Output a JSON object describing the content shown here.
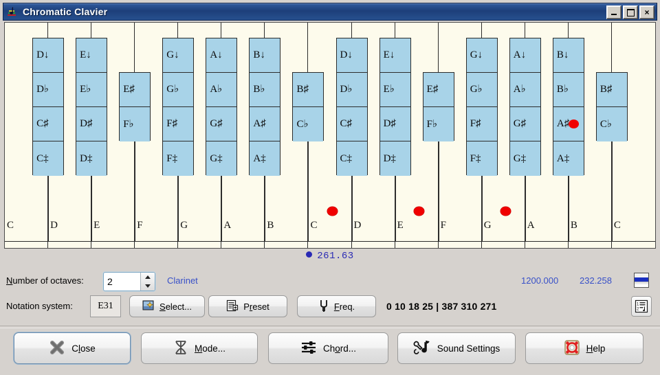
{
  "window": {
    "title": "Chromatic Clavier",
    "icon": "music-note-icon",
    "minimize_label": "_",
    "maximize_label": "",
    "close_label": "×"
  },
  "keyboard": {
    "white_keys": [
      {
        "label": "C",
        "dot": false
      },
      {
        "label": "D",
        "dot": false
      },
      {
        "label": "E",
        "dot": false
      },
      {
        "label": "F",
        "dot": false
      },
      {
        "label": "G",
        "dot": false
      },
      {
        "label": "A",
        "dot": false
      },
      {
        "label": "B",
        "dot": false
      },
      {
        "label": "C",
        "dot": true
      },
      {
        "label": "D",
        "dot": false
      },
      {
        "label": "E",
        "dot": true
      },
      {
        "label": "F",
        "dot": false
      },
      {
        "label": "G",
        "dot": true
      },
      {
        "label": "A",
        "dot": false
      },
      {
        "label": "B",
        "dot": false
      },
      {
        "label": "C",
        "dot": false
      }
    ],
    "accidental_groups": [
      {
        "names": [
          "D↓",
          "D♭",
          "C♯",
          "C‡"
        ],
        "dot": false
      },
      {
        "names": [
          "E↓",
          "E♭",
          "D♯",
          "D‡"
        ],
        "dot": false
      },
      {
        "names": [
          "E♯",
          "F♭"
        ],
        "dot": false
      },
      {
        "names": [
          "G↓",
          "G♭",
          "F♯",
          "F‡"
        ],
        "dot": false
      },
      {
        "names": [
          "A↓",
          "A♭",
          "G♯",
          "G‡"
        ],
        "dot": false
      },
      {
        "names": [
          "B↓",
          "B♭",
          "A♯",
          "A‡"
        ],
        "dot": false
      },
      {
        "names": [
          "B♯",
          "C♭"
        ],
        "dot": false
      },
      {
        "names": [
          "D↓",
          "D♭",
          "C♯",
          "C‡"
        ],
        "dot": false
      },
      {
        "names": [
          "E↓",
          "E♭",
          "D♯",
          "D‡"
        ],
        "dot": false
      },
      {
        "names": [
          "E♯",
          "F♭"
        ],
        "dot": false
      },
      {
        "names": [
          "G↓",
          "G♭",
          "F♯",
          "F‡"
        ],
        "dot": false
      },
      {
        "names": [
          "A↓",
          "A♭",
          "G♯",
          "G‡"
        ],
        "dot": false
      },
      {
        "names": [
          "B↓",
          "B♭",
          "A♯",
          "A‡"
        ],
        "dot": true
      },
      {
        "names": [
          "B♯",
          "C♭"
        ],
        "dot": false
      }
    ],
    "colors": {
      "white_key": "#fdfbec",
      "accidental_key": "#a8d3e8",
      "selected_dot": "#f00000",
      "outline": "#2c2c2c"
    }
  },
  "frequency": {
    "value": "261.63",
    "marker": "blue-dot"
  },
  "controls": {
    "octaves_label_pre": "N",
    "octaves_label_post": "umber of octaves:",
    "octaves_value": "2",
    "spin_up": "spinner-up-icon",
    "spin_down": "spinner-down-icon",
    "instrument": "Clarinet",
    "cents_total": "1200.000",
    "cents_step": "232.258",
    "stripe_icon": "color-bar-icon"
  },
  "notation": {
    "label": "Notation system:",
    "value": "E31",
    "select_pre": "",
    "select_label_a": "S",
    "select_label_b": "elect...",
    "select_icon": "wizard-star-icon",
    "preset_label_a": "P",
    "preset_label_b": "r",
    "preset_label_c": "eset",
    "preset_icon": "document-export-icon",
    "freq_label_a": "F",
    "freq_label_b": "req.",
    "freq_icon": "tuning-fork-icon",
    "ratios": "0 10 18 25  |  387 310 271",
    "list_icon": "numbered-list-icon"
  },
  "buttons": [
    {
      "id": "close",
      "icon": "x-cross-icon",
      "pre": "C",
      "accel": "l",
      "post": "ose",
      "text": "Close"
    },
    {
      "id": "mode",
      "icon": "mode-column-icon",
      "pre": "",
      "accel": "M",
      "post": "ode...",
      "text": "Mode..."
    },
    {
      "id": "chord",
      "icon": "sliders-icon",
      "pre": "Ch",
      "accel": "o",
      "post": "rd...",
      "text": "Chord..."
    },
    {
      "id": "sound",
      "icon": "wrench-note-icon",
      "pre": "Sound Settin",
      "accel": "g",
      "post": "s",
      "text": "Sound Settings"
    },
    {
      "id": "help",
      "icon": "lifebuoy-icon",
      "pre": "",
      "accel": "H",
      "post": "elp",
      "text": "Help"
    }
  ]
}
